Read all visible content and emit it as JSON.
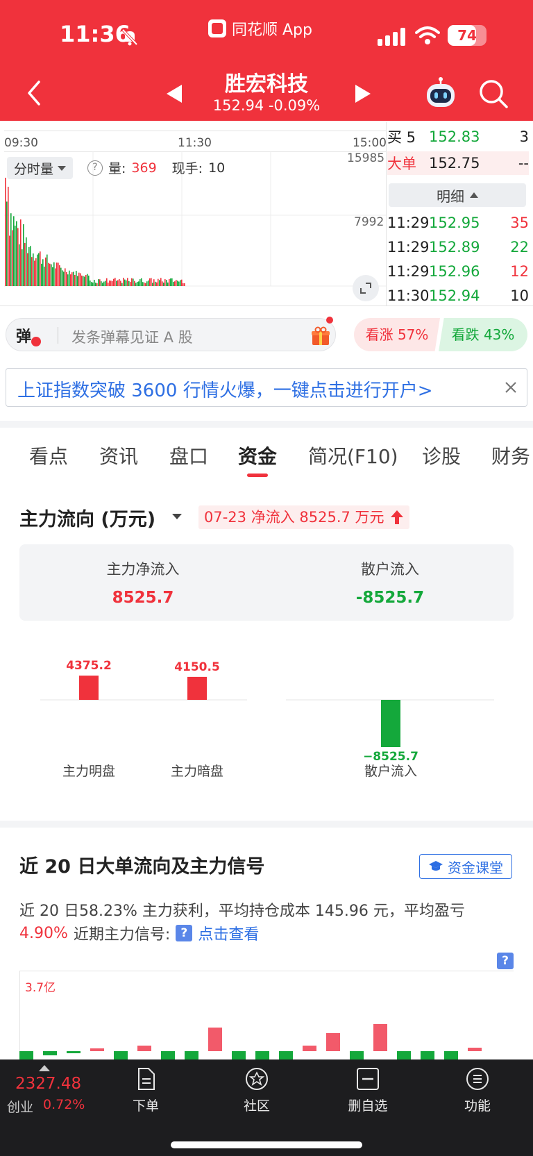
{
  "status": {
    "time": "11:36",
    "battery": "74",
    "battery_level": 0.74
  },
  "app": {
    "name": "同花顺 App"
  },
  "stock": {
    "name": "胜宏科技",
    "price_line": "152.94 -0.09%"
  },
  "chart": {
    "time_labels": [
      "09:30",
      "11:30",
      "15:00"
    ],
    "volume_selector": "分时量",
    "volume_label": "量:",
    "volume_value": "369",
    "hand_label": "现手:",
    "hand_value": "10",
    "vol_max": "15985",
    "vol_mid": "7992"
  },
  "orderbook": {
    "buy5": {
      "label": "买 5",
      "price": "152.83",
      "qty": "3"
    },
    "big": {
      "label": "大单",
      "price": "152.75",
      "qty": "--"
    },
    "detail_header": "明细",
    "trades": [
      {
        "time": "11:29",
        "price": "152.95",
        "qty": "35",
        "side": "buy"
      },
      {
        "time": "11:29",
        "price": "152.89",
        "qty": "22",
        "side": "sell"
      },
      {
        "time": "11:29",
        "price": "152.96",
        "qty": "12",
        "side": "buy"
      },
      {
        "time": "11:30",
        "price": "152.94",
        "qty": "10",
        "side": "neutral"
      }
    ]
  },
  "comment": {
    "badge": "弹",
    "placeholder": "发条弹幕见证 A 股"
  },
  "sentiment": {
    "bull": "看涨 57%",
    "bear": "看跌 43%"
  },
  "ad": {
    "text": "上证指数突破 3600 行情火爆，一键点击进行开户>"
  },
  "tabs": [
    "看点",
    "资讯",
    "盘口",
    "资金",
    "简况(F10)",
    "诊股",
    "财务"
  ],
  "active_tab": "资金",
  "flow": {
    "title": "主力流向 (万元)",
    "badge": "07-23 净流入 8525.7 万元",
    "main_net_label": "主力净流入",
    "main_net_value": "8525.7",
    "retail_label": "散户流入",
    "retail_value": "-8525.7"
  },
  "chart_data": {
    "type": "bar",
    "categories": [
      "主力明盘",
      "主力暗盘",
      "散户流入"
    ],
    "values": [
      4375.2,
      4150.5,
      -8525.7
    ],
    "value_labels": [
      "4375.2",
      "4150.5",
      "−8525.7"
    ]
  },
  "section2": {
    "title": "近 20 日大单流向及主力信号",
    "class_button": "资金课堂",
    "text1": "近 20 日58.23% 主力获利，平均持仓成本 145.96 元，平均盈亏",
    "pct": "4.90%",
    "signal_label": "近期主力信号:",
    "q": "?",
    "link": "点击查看",
    "max_label": "3.7亿"
  },
  "bottom": {
    "index_value": "2327.48",
    "index_name": "创业",
    "index_pct": "0.72%",
    "nav": [
      "下单",
      "社区",
      "删自选",
      "功能"
    ]
  },
  "colors": {
    "brand": "#f0323c",
    "up": "#f0323c",
    "down": "#14a83b",
    "link": "#2e6fe3"
  }
}
